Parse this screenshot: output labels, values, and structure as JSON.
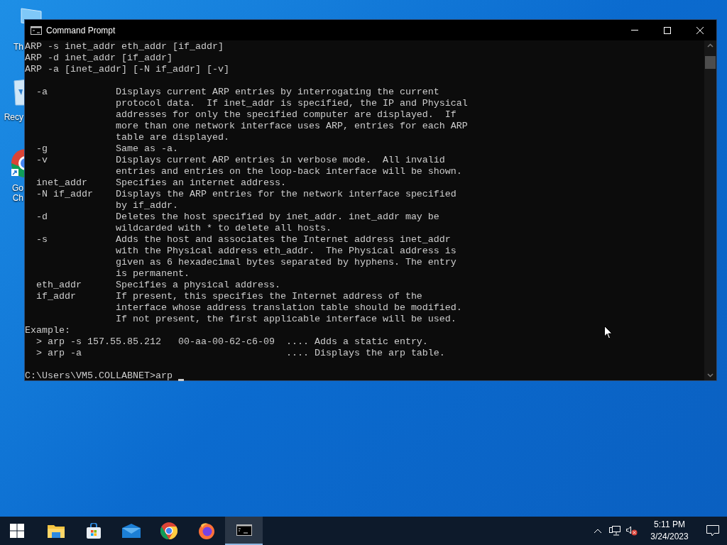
{
  "desktop": {
    "icons": [
      {
        "kind": "computer",
        "label_lines": [
          "Th"
        ]
      },
      {
        "kind": "recycle-bin",
        "label_lines": [
          "Recy"
        ]
      },
      {
        "kind": "browser",
        "label_lines": [
          "Go",
          "Ch"
        ]
      }
    ]
  },
  "window": {
    "title": "Command Prompt",
    "terminal": {
      "blocks": [
        {
          "lines": [
            "ARP -s inet_addr eth_addr [if_addr]",
            "ARP -d inet_addr [if_addr]",
            "ARP -a [inet_addr] [-N if_addr] [-v]"
          ]
        },
        {
          "lines": [
            "  -a            Displays current ARP entries by interrogating the current",
            "                protocol data.  If inet_addr is specified, the IP and Physical",
            "                addresses for only the specified computer are displayed.  If",
            "                more than one network interface uses ARP, entries for each ARP",
            "                table are displayed.",
            "  -g            Same as -a.",
            "  -v            Displays current ARP entries in verbose mode.  All invalid",
            "                entries and entries on the loop-back interface will be shown.",
            "  inet_addr     Specifies an internet address.",
            "  -N if_addr    Displays the ARP entries for the network interface specified",
            "                by if_addr.",
            "  -d            Deletes the host specified by inet_addr. inet_addr may be",
            "                wildcarded with * to delete all hosts.",
            "  -s            Adds the host and associates the Internet address inet_addr",
            "                with the Physical address eth_addr.  The Physical address is",
            "                given as 6 hexadecimal bytes separated by hyphens. The entry",
            "                is permanent.",
            "  eth_addr      Specifies a physical address.",
            "  if_addr       If present, this specifies the Internet address of the",
            "                interface whose address translation table should be modified.",
            "                If not present, the first applicable interface will be used.",
            "Example:",
            "  > arp -s 157.55.85.212   00-aa-00-62-c6-09  .... Adds a static entry.",
            "  > arp -a                                    .... Displays the arp table."
          ]
        }
      ],
      "prompt": "C:\\Users\\VM5.COLLABNET>arp"
    }
  },
  "taskbar": {
    "apps": [
      {
        "kind": "file-explorer",
        "selected": false
      },
      {
        "kind": "store",
        "selected": false
      },
      {
        "kind": "mail",
        "selected": false
      },
      {
        "kind": "chrome",
        "selected": false
      },
      {
        "kind": "firefox",
        "selected": false
      },
      {
        "kind": "terminal",
        "selected": true
      }
    ],
    "clock": {
      "time": "5:11 PM",
      "date": "3/24/2023"
    }
  }
}
